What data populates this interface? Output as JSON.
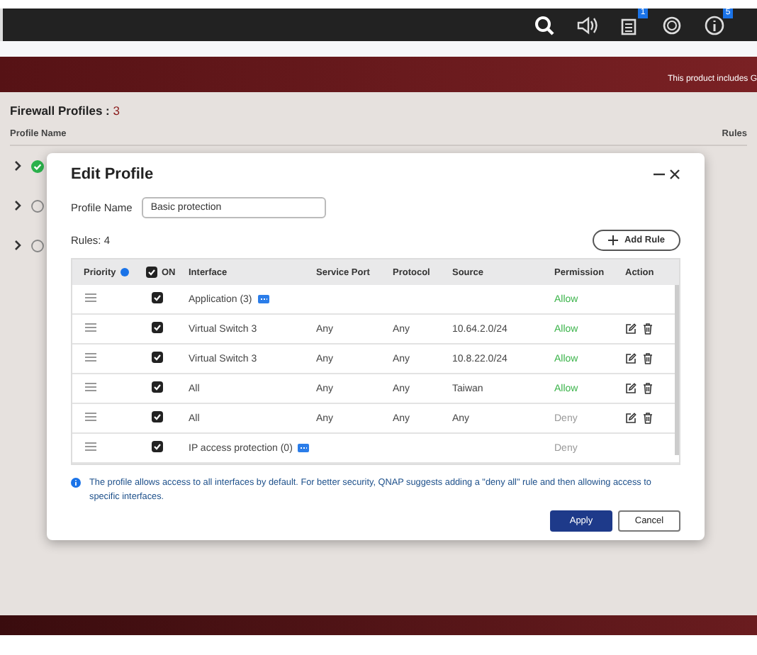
{
  "toolbar_icons": [
    {
      "kind": "search"
    },
    {
      "kind": "volume"
    },
    {
      "kind": "tasks",
      "badge": "1"
    },
    {
      "kind": "sync"
    },
    {
      "kind": "info",
      "badge": "5"
    }
  ],
  "banner": {
    "text": "This product includes G"
  },
  "page": {
    "title": "Firewall Profiles : ",
    "count": "3",
    "columns": [
      "Profile Name",
      "Rules"
    ],
    "profiles": [
      {
        "expanded": false,
        "active": true
      },
      {
        "expanded": false,
        "active": false
      },
      {
        "expanded": false,
        "active": false
      }
    ]
  },
  "dialog": {
    "title": "Edit Profile",
    "profile_name_label": "Profile Name",
    "profile_name": "Basic protection",
    "rules_count": "Rules: 4",
    "add_rule": "Add Rule",
    "columns": [
      "Priority",
      "ON",
      "Interface",
      "Service Port",
      "Protocol",
      "Source",
      "Permission",
      "Action"
    ],
    "all_on": true,
    "rules": [
      {
        "on": true,
        "interface": "Application (3)",
        "has_list": true,
        "permission": "Allow",
        "allowed": true,
        "editable": false
      },
      {
        "on": true,
        "interface": "Virtual Switch 3",
        "has_list": false,
        "service_port": "Any",
        "protocol": "Any",
        "source": "10.64.2.0/24",
        "permission": "Allow",
        "allowed": true,
        "editable": true
      },
      {
        "on": true,
        "interface": "Virtual Switch 3",
        "has_list": false,
        "service_port": "Any",
        "protocol": "Any",
        "source": "10.8.22.0/24",
        "permission": "Allow",
        "allowed": true,
        "editable": true
      },
      {
        "on": true,
        "interface": "All",
        "has_list": false,
        "service_port": "Any",
        "protocol": "Any",
        "source": "Taiwan",
        "permission": "Allow",
        "allowed": true,
        "editable": true
      },
      {
        "on": true,
        "interface": "All",
        "has_list": false,
        "service_port": "Any",
        "protocol": "Any",
        "source": "Any",
        "permission": "Deny",
        "allowed": false,
        "editable": true
      },
      {
        "on": true,
        "interface": "IP access protection (0)",
        "has_list": true,
        "permission": "Deny",
        "allowed": false,
        "editable": false
      }
    ],
    "note": "The profile allows access to all interfaces by default. For better security, QNAP suggests adding a \"deny all\" rule and then allowing access to specific interfaces.",
    "buttons": [
      {
        "label": "Apply",
        "primary": true
      },
      {
        "label": "Cancel",
        "primary": false
      }
    ]
  }
}
